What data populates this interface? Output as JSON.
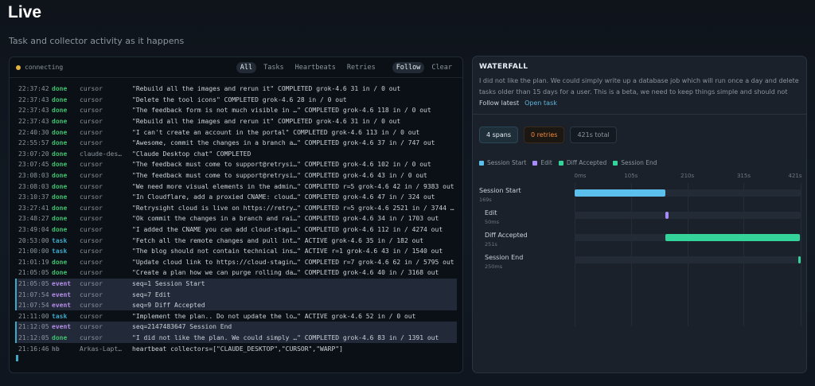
{
  "page": {
    "title": "Live",
    "subtitle": "Task and collector activity as it happens"
  },
  "log": {
    "status": "connecting",
    "filters": [
      {
        "label": "All",
        "active": true
      },
      {
        "label": "Tasks",
        "active": false
      },
      {
        "label": "Heartbeats",
        "active": false
      },
      {
        "label": "Retries",
        "active": false
      }
    ],
    "follow_label": "Follow",
    "clear_label": "Clear",
    "lines": [
      {
        "time": "22:37:42",
        "kind": "done",
        "source": "cursor",
        "message": "\"Rebuild all the images and rerun it\" COMPLETED grok-4.6 31 in / 0 out",
        "highlight": false
      },
      {
        "time": "22:37:43",
        "kind": "done",
        "source": "cursor",
        "message": "\"Delete the tool icons\" COMPLETED grok-4.6 28 in / 0 out",
        "highlight": false
      },
      {
        "time": "22:37:43",
        "kind": "done",
        "source": "cursor",
        "message": "\"The feedback form is not much visible in …\" COMPLETED grok-4.6 118 in / 0 out",
        "highlight": false
      },
      {
        "time": "22:37:43",
        "kind": "done",
        "source": "cursor",
        "message": "\"Rebuild all the images and rerun it\" COMPLETED grok-4.6 31 in / 0 out",
        "highlight": false
      },
      {
        "time": "22:40:30",
        "kind": "done",
        "source": "cursor",
        "message": "\"I can't create an account in the portal\" COMPLETED grok-4.6 113 in / 0 out",
        "highlight": false
      },
      {
        "time": "22:55:57",
        "kind": "done",
        "source": "cursor",
        "message": "\"Awesome, commit the changes in a branch a…\" COMPLETED grok-4.6 37 in / 747 out",
        "highlight": false
      },
      {
        "time": "23:07:20",
        "kind": "done",
        "source": "claude-des…",
        "message": "\"Claude Desktop chat\" COMPLETED",
        "highlight": false
      },
      {
        "time": "23:07:45",
        "kind": "done",
        "source": "cursor",
        "message": "\"The feedback must come to support@retrysi…\" COMPLETED grok-4.6 102 in / 0 out",
        "highlight": false
      },
      {
        "time": "23:08:03",
        "kind": "done",
        "source": "cursor",
        "message": "\"The feedback must come to support@retrysi…\" COMPLETED grok-4.6 43 in / 0 out",
        "highlight": false
      },
      {
        "time": "23:08:03",
        "kind": "done",
        "source": "cursor",
        "message": "\"We need more visual elements in the admin…\" COMPLETED r=5 grok-4.6 42 in / 9383 out",
        "highlight": false
      },
      {
        "time": "23:10:37",
        "kind": "done",
        "source": "cursor",
        "message": "\"In Cloudflare, add a proxied CNAME: cloud…\" COMPLETED grok-4.6 47 in / 324 out",
        "highlight": false
      },
      {
        "time": "23:27:41",
        "kind": "done",
        "source": "cursor",
        "message": "\"Retrysight cloud is live on https://retry…\" COMPLETED r=5 grok-4.6 2521 in / 3744 …",
        "highlight": false
      },
      {
        "time": "23:48:27",
        "kind": "done",
        "source": "cursor",
        "message": "\"Ok commit the changes in a branch and rai…\" COMPLETED grok-4.6 34 in / 1703 out",
        "highlight": false
      },
      {
        "time": "23:49:04",
        "kind": "done",
        "source": "cursor",
        "message": "\"I added the CNAME you can add cloud-stagi…\" COMPLETED grok-4.6 112 in / 4274 out",
        "highlight": false
      },
      {
        "time": "20:53:00",
        "kind": "task",
        "source": "cursor",
        "message": "\"Fetch all the remote changes and pull int…\" ACTIVE grok-4.6 35 in / 182 out",
        "highlight": false
      },
      {
        "time": "21:00:00",
        "kind": "task",
        "source": "cursor",
        "message": "\"The blog should not contain technical ins…\" ACTIVE r=1 grok-4.6 43 in / 1540 out",
        "highlight": false
      },
      {
        "time": "21:01:19",
        "kind": "done",
        "source": "cursor",
        "message": "\"Update cloud link to https://cloud-stagin…\" COMPLETED r=7 grok-4.6 62 in / 5795 out",
        "highlight": false
      },
      {
        "time": "21:05:05",
        "kind": "done",
        "source": "cursor",
        "message": "\"Create a plan how we can purge rolling da…\" COMPLETED grok-4.6 40 in / 3168 out",
        "highlight": false
      },
      {
        "time": "21:05:05",
        "kind": "event",
        "source": "cursor",
        "message": "seq=1 Session Start",
        "highlight": true
      },
      {
        "time": "21:07:54",
        "kind": "event",
        "source": "cursor",
        "message": "seq=7 Edit",
        "highlight": true
      },
      {
        "time": "21:07:54",
        "kind": "event",
        "source": "cursor",
        "message": "seq=9 Diff Accepted",
        "highlight": true
      },
      {
        "time": "21:11:00",
        "kind": "task",
        "source": "cursor",
        "message": "\"Implement the plan.. Do not update the lo…\" ACTIVE grok-4.6 52 in / 0 out",
        "highlight": false
      },
      {
        "time": "21:12:05",
        "kind": "event",
        "source": "cursor",
        "message": "seq=2147483647 Session End",
        "highlight": true
      },
      {
        "time": "21:12:05",
        "kind": "done",
        "source": "cursor",
        "message": "\"I did not like the plan. We could simply …\" COMPLETED grok-4.6 83 in / 1391 out",
        "highlight": true
      },
      {
        "time": "21:16:46",
        "kind": "hb",
        "source": "Arkas-Lapt…",
        "message": "heartbeat collectors=[\"CLAUDE_DESKTOP\",\"CURSOR\",\"WARP\"]",
        "highlight": false
      }
    ]
  },
  "waterfall": {
    "title": "WATERFALL",
    "description": "I did not like the plan. We could simply write up a database job which will run once a day and delete tasks older than 15 days for a user. This is a beta, we need to keep things simple and should not add a feature...",
    "follow_latest_label": "Follow latest",
    "open_task_label": "Open task",
    "badges": {
      "spans": "4 spans",
      "retries": "0 retries",
      "total": "421s total"
    },
    "legend": [
      {
        "label": "Session Start",
        "color": "#5bc0eb"
      },
      {
        "label": "Edit",
        "color": "#a78bfa"
      },
      {
        "label": "Diff Accepted",
        "color": "#34d399"
      },
      {
        "label": "Session End",
        "color": "#34d399"
      }
    ],
    "axis": {
      "max_seconds": 421,
      "ticks": [
        {
          "value": 0,
          "label": "0ms"
        },
        {
          "value": 105,
          "label": "105s"
        },
        {
          "value": 210,
          "label": "210s"
        },
        {
          "value": 315,
          "label": "315s"
        },
        {
          "value": 421,
          "label": "421s"
        }
      ]
    },
    "spans": [
      {
        "name": "Session Start",
        "duration": "169s",
        "start": 0,
        "end": 169,
        "color": "#5bc0eb",
        "indent": false
      },
      {
        "name": "Edit",
        "duration": "50ms",
        "start": 169,
        "end": 175,
        "color": "#a78bfa",
        "indent": true
      },
      {
        "name": "Diff Accepted",
        "duration": "251s",
        "start": 169,
        "end": 420,
        "color": "#34d399",
        "indent": true
      },
      {
        "name": "Session End",
        "duration": "250ms",
        "start": 420,
        "end": 421,
        "color": "#34d399",
        "indent": true
      }
    ]
  }
}
